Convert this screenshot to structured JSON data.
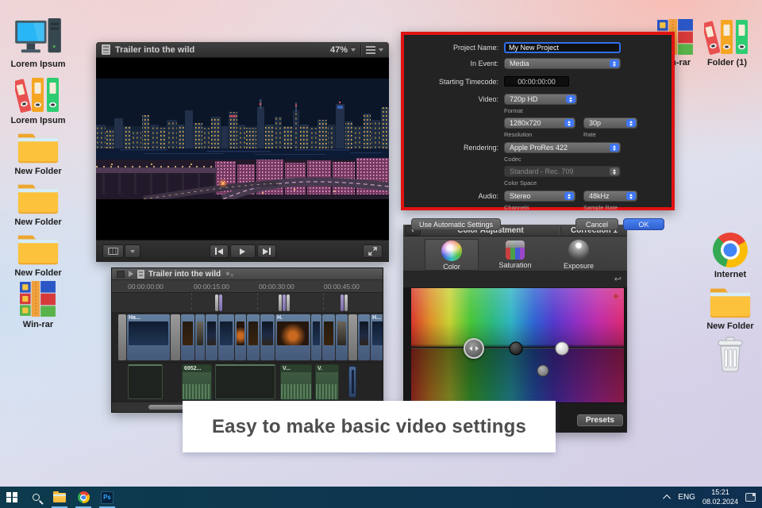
{
  "colors": {
    "dialog_border": "#e01313",
    "accent_blue": "#3e76f4",
    "taskbar_bg": "#0e3a4e",
    "banner_bg": "#ffffff",
    "banner_text": "#4d4d4d"
  },
  "desktop": {
    "icons_left": [
      {
        "label": "Lorem Ipsum"
      },
      {
        "label": "Lorem Ipsum"
      },
      {
        "label": "New Folder"
      },
      {
        "label": "New Folder"
      },
      {
        "label": "New Folder"
      },
      {
        "label": "Win-rar"
      }
    ],
    "icons_right": [
      {
        "label": "Win-rar"
      },
      {
        "label": "Folder (1)"
      },
      {
        "label": "Internet"
      },
      {
        "label": "New Folder"
      },
      {
        "label": ""
      }
    ]
  },
  "viewer": {
    "title": "Trailer into the wild",
    "zoom_level": "47%"
  },
  "timeline": {
    "title": "Trailer into the wild",
    "ruler_ticks": [
      "00:00:00:00",
      "00:00:15:00",
      "00:00:30:00",
      "00:00:45:00"
    ],
    "clip_labels": [
      "Ha...",
      "H.",
      "H..."
    ],
    "audio_labels": [
      "6952...",
      "V...",
      "V."
    ]
  },
  "dialog": {
    "project_name_label": "Project Name:",
    "project_name_value": "My New Project",
    "in_event_label": "In Event:",
    "in_event_value": "Media",
    "starting_timecode_label": "Starting Timecode:",
    "starting_timecode_value": "00:00:00:00",
    "video_label": "Video:",
    "video_value": "720p HD",
    "video_caption": "Format",
    "resolution_value": "1280x720",
    "resolution_caption": "Resolution",
    "rate_value": "30p",
    "rate_caption": "Rate",
    "rendering_label": "Rendering:",
    "codec_value": "Apple ProRes 422",
    "codec_caption": "Codec",
    "color_space_value": "Standard - Rec. 709",
    "color_space_caption": "Color Space",
    "audio_label": "Audio:",
    "channels_value": "Stereo",
    "channels_caption": "Channels",
    "sample_rate_value": "48kHz",
    "sample_rate_caption": "Sample Rate",
    "use_automatic_settings": "Use Automatic Settings",
    "cancel": "Cancel",
    "ok": "OK"
  },
  "color_panel": {
    "title": "Color Adjustment",
    "correction_label": "Correction 1",
    "tabs": [
      {
        "label": "Color"
      },
      {
        "label": "Saturation"
      },
      {
        "label": "Exposure"
      }
    ],
    "presets_button": "Presets"
  },
  "banner": {
    "text": "Easy to make basic video settings"
  },
  "taskbar": {
    "ps_label": "Ps",
    "language": "ENG",
    "time": "15:21",
    "date": "08.02.2024"
  }
}
